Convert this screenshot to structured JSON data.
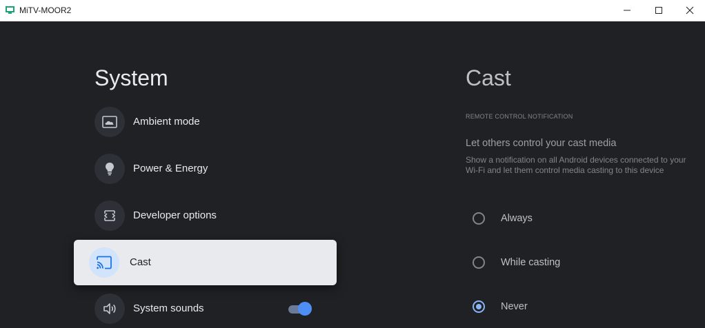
{
  "window": {
    "title": "MiTV-MOOR2",
    "icon": "tv-app-icon",
    "controls": [
      "minimize-icon",
      "maximize-icon",
      "close-icon"
    ]
  },
  "system": {
    "title": "System",
    "items": [
      {
        "label": "Ambient mode",
        "icon": "ambient-mode-icon"
      },
      {
        "label": "Power & Energy",
        "icon": "lightbulb-icon"
      },
      {
        "label": "Developer options",
        "icon": "developer-options-icon"
      },
      {
        "label": "Cast",
        "icon": "cast-icon",
        "selected": true
      },
      {
        "label": "System sounds",
        "icon": "volume-icon",
        "toggle_on": true
      }
    ]
  },
  "cast_panel": {
    "title": "Cast",
    "section_label": "REMOTE CONTROL NOTIFICATION",
    "pref_title": "Let others control your cast media",
    "pref_description": "Show a notification on all Android devices connected to your Wi-Fi and let them control media casting to this device",
    "options": [
      {
        "label": "Always",
        "checked": false
      },
      {
        "label": "While casting",
        "checked": false
      },
      {
        "label": "Never",
        "checked": true
      }
    ]
  },
  "colors": {
    "background": "#202124",
    "selected_card": "#e8eaed",
    "accent": "#8ab4f8",
    "toggle_thumb": "#4d8ff5"
  }
}
